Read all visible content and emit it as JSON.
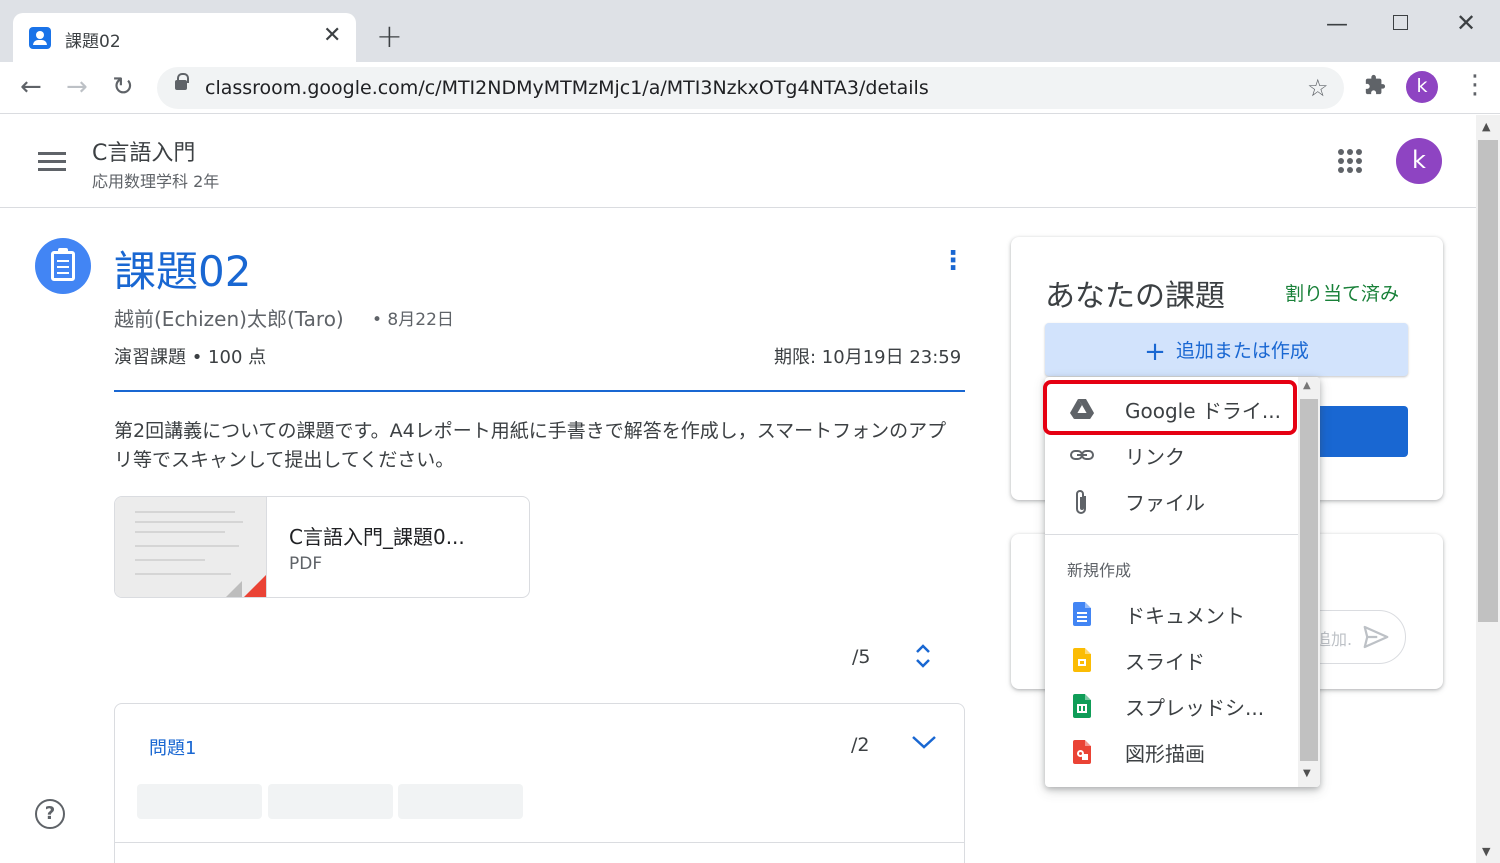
{
  "browser": {
    "tab_title": "課題02",
    "tab_close": "✕",
    "new_tab": "+",
    "url": "classroom.google.com/c/MTI2NDMyMTMzMjc1/a/MTI3NzkxOTg4NTA3/details",
    "profile_initial": "k"
  },
  "header": {
    "class_name": "C言語入門",
    "class_section": "応用数理学科 2年",
    "profile_initial": "k"
  },
  "assignment": {
    "title": "課題02",
    "author": "越前(Echizen)太郎(Taro)",
    "posted_date": "• 8月22日",
    "points": "演習課題 • 100 点",
    "due": "期限: 10月19日 23:59",
    "description": "第2回講義についての課題です。A4レポート用紙に手書きで解答を作成し，スマートフォンのアプリ等でスキャンして提出してください。",
    "attachment": {
      "name": "C言語入門_課題0...",
      "type": "PDF"
    },
    "score_total": "/5"
  },
  "question": {
    "label": "問題1",
    "score": "/2"
  },
  "your_work": {
    "title": "あなたの課題",
    "status": "割り当て済み",
    "add_button": "追加または作成"
  },
  "comment": {
    "placeholder": "追加."
  },
  "menu": {
    "items": [
      {
        "label": "Google ドライ...",
        "icon": "google-drive-icon"
      },
      {
        "label": "リンク",
        "icon": "link-icon"
      },
      {
        "label": "ファイル",
        "icon": "paperclip-icon"
      }
    ],
    "section_label": "新規作成",
    "create_items": [
      {
        "label": "ドキュメント",
        "icon": "docs-icon",
        "color": "#4285f4"
      },
      {
        "label": "スライド",
        "icon": "slides-icon",
        "color": "#fbbc04"
      },
      {
        "label": "スプレッドシ...",
        "icon": "sheets-icon",
        "color": "#0f9d58"
      },
      {
        "label": "図形描画",
        "icon": "drawings-icon",
        "color": "#ea4335"
      }
    ]
  },
  "colors": {
    "accent": "#1967d2",
    "assigned_green": "#188038",
    "highlight_red": "#e50012"
  }
}
